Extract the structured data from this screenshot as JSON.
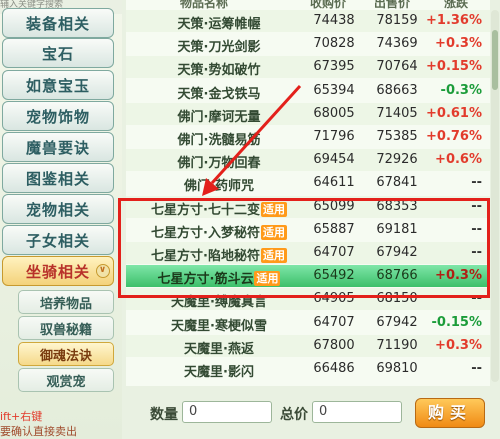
{
  "sidebar": {
    "top_hint": "辅入关键字搜索",
    "categories": [
      {
        "label": "装备相关"
      },
      {
        "label": "宝石"
      },
      {
        "label": "如意宝玉"
      },
      {
        "label": "宠物饰物"
      },
      {
        "label": "魔兽要诀"
      },
      {
        "label": "图鉴相关"
      },
      {
        "label": "宠物相关"
      },
      {
        "label": "子女相关"
      },
      {
        "label": "坐骑相关"
      }
    ],
    "subcategories": [
      {
        "label": "培养物品"
      },
      {
        "label": "驭兽秘籍"
      },
      {
        "label": "御魂法诀"
      },
      {
        "label": "观赏宠"
      }
    ],
    "bottom_hint_1": "ift+右键",
    "bottom_hint_2": "要确认直接卖出",
    "active_chevron": "∨"
  },
  "table": {
    "headers": {
      "name": "物品名称",
      "buy": "收购价",
      "sell": "出售价",
      "change": "涨跌"
    },
    "usable_tag": "适用",
    "rows": [
      {
        "name": "天策·运筹帷幄",
        "buy": "74438",
        "sell": "78159",
        "change": "+1.36%",
        "dir": "up"
      },
      {
        "name": "天策·刀光剑影",
        "buy": "70828",
        "sell": "74369",
        "change": "+0.3%",
        "dir": "up"
      },
      {
        "name": "天策·势如破竹",
        "buy": "67395",
        "sell": "70764",
        "change": "+0.15%",
        "dir": "up"
      },
      {
        "name": "天策·金戈铁马",
        "buy": "65394",
        "sell": "68663",
        "change": "-0.3%",
        "dir": "down"
      },
      {
        "name": "佛门·摩诃无量",
        "buy": "68005",
        "sell": "71405",
        "change": "+0.61%",
        "dir": "up"
      },
      {
        "name": "佛门·洗髓易筋",
        "buy": "71796",
        "sell": "75385",
        "change": "+0.76%",
        "dir": "up"
      },
      {
        "name": "佛门·万物回春",
        "buy": "69454",
        "sell": "72926",
        "change": "+0.6%",
        "dir": "up"
      },
      {
        "name": "佛门·药师咒",
        "buy": "64611",
        "sell": "67841",
        "change": "--",
        "dir": "flat"
      },
      {
        "name": "七星方寸·七十二变",
        "buy": "65099",
        "sell": "68353",
        "change": "--",
        "dir": "flat",
        "usable": true
      },
      {
        "name": "七星方寸·入梦秘符",
        "buy": "65887",
        "sell": "69181",
        "change": "--",
        "dir": "flat",
        "usable": true
      },
      {
        "name": "七星方寸·陷地秘符",
        "buy": "64707",
        "sell": "67942",
        "change": "--",
        "dir": "flat",
        "usable": true
      },
      {
        "name": "七星方寸·筋斗云",
        "buy": "65492",
        "sell": "68766",
        "change": "+0.3%",
        "dir": "up",
        "usable": true,
        "selected": true
      },
      {
        "name": "天魔里·缚魔真言",
        "buy": "64905",
        "sell": "68150",
        "change": "--",
        "dir": "flat"
      },
      {
        "name": "天魔里·寒梗似雪",
        "buy": "64707",
        "sell": "67942",
        "change": "-0.15%",
        "dir": "down"
      },
      {
        "name": "天魔里·燕返",
        "buy": "67800",
        "sell": "71190",
        "change": "+0.3%",
        "dir": "up"
      },
      {
        "name": "天魔里·影闪",
        "buy": "66486",
        "sell": "69810",
        "change": "--",
        "dir": "flat"
      }
    ]
  },
  "footer": {
    "quantity_label": "数量",
    "quantity_value": "0",
    "total_label": "总价",
    "total_value": "0",
    "buy_button": "购买"
  },
  "colors": {
    "highlight_box": "#e3201b",
    "arrow": "#e3201b",
    "rise": "#e23b2c",
    "fall": "#1b9c3a"
  }
}
